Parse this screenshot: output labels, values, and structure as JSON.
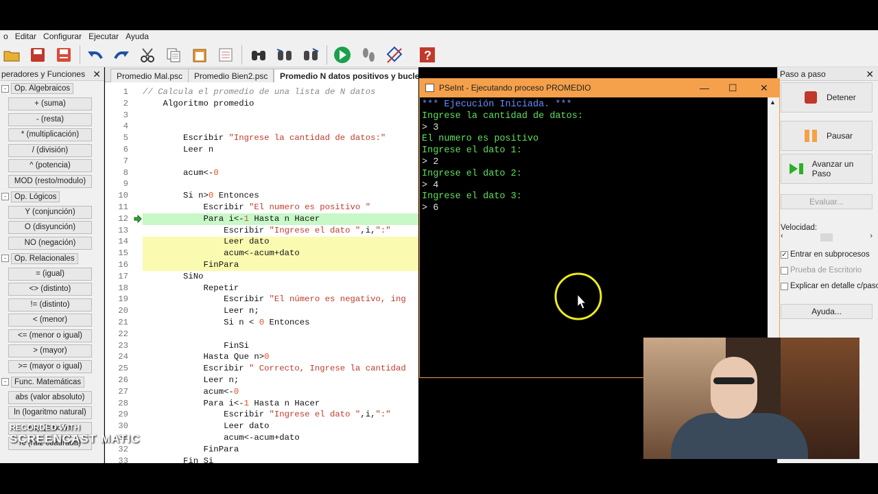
{
  "menu": [
    "o",
    "Editar",
    "Configurar",
    "Ejecutar",
    "Ayuda"
  ],
  "left_panel": {
    "title": "perador es y Funciones",
    "title_text": "peradores y Funciones",
    "items": [
      {
        "kind": "cat",
        "label": "Op. Algebraicos",
        "box": "-"
      },
      {
        "kind": "op",
        "label": "+ (suma)"
      },
      {
        "kind": "op",
        "label": "- (resta)"
      },
      {
        "kind": "op",
        "label": "* (multiplicación)"
      },
      {
        "kind": "op",
        "label": "/ (división)"
      },
      {
        "kind": "op",
        "label": "^ (potencia)"
      },
      {
        "kind": "op",
        "label": "MOD (resto/modulo)"
      },
      {
        "kind": "cat",
        "label": "Op. Lógicos",
        "box": "-"
      },
      {
        "kind": "op",
        "label": "Y (conjunción)"
      },
      {
        "kind": "op",
        "label": "O (disyunción)"
      },
      {
        "kind": "op",
        "label": "NO (negación)"
      },
      {
        "kind": "cat",
        "label": "Op. Relacionales",
        "box": "-"
      },
      {
        "kind": "op",
        "label": "= (igual)"
      },
      {
        "kind": "op",
        "label": "<> (distinto)"
      },
      {
        "kind": "op",
        "label": "!= (distinto)"
      },
      {
        "kind": "op",
        "label": "< (menor)"
      },
      {
        "kind": "op",
        "label": "<= (menor o igual)"
      },
      {
        "kind": "op",
        "label": "> (mayor)"
      },
      {
        "kind": "op",
        "label": ">= (mayor o igual)"
      },
      {
        "kind": "cat",
        "label": "Func. Matemáticas",
        "box": "-"
      },
      {
        "kind": "op",
        "label": "abs (valor absoluto)"
      },
      {
        "kind": "op",
        "label": "ln (logaritmo natural)"
      },
      {
        "kind": "op",
        "label": "exp (función exponencial)"
      },
      {
        "kind": "op",
        "label": "rc (raiz cuadrada)"
      }
    ]
  },
  "tabs": [
    "Promedio Mal.psc",
    "Promedio Bien2.psc",
    "Promedio N datos positivos y bucle.psc"
  ],
  "code_lines": [
    {
      "n": "1",
      "t": "// Calcula el promedio de una lista de N datos",
      "style": "cmt"
    },
    {
      "n": "2",
      "t": "    Algoritmo promedio",
      "style": "kw"
    },
    {
      "n": "3",
      "t": "",
      "style": "kw"
    },
    {
      "n": "4",
      "t": "",
      "style": "kw"
    },
    {
      "n": "5",
      "t": "        Escribir \"Ingrese la cantidad de datos:\"",
      "style": "mix"
    },
    {
      "n": "6",
      "t": "        Leer n",
      "style": "kw"
    },
    {
      "n": "7",
      "t": "",
      "style": "kw"
    },
    {
      "n": "8",
      "t": "        acum<-0",
      "style": "kw"
    },
    {
      "n": "9",
      "t": "",
      "style": "kw"
    },
    {
      "n": "10",
      "t": "        Si n>0 Entonces",
      "style": "kw"
    },
    {
      "n": "11",
      "t": "            Escribir \"El numero es positivo \"",
      "style": "mix"
    },
    {
      "n": "12",
      "t": "            Para i<-1 Hasta n Hacer",
      "style": "kw"
    },
    {
      "n": "13",
      "t": "                Escribir \"Ingrese el dato \",i,\":\"",
      "style": "mix"
    },
    {
      "n": "14",
      "t": "                Leer dato",
      "style": "kw"
    },
    {
      "n": "15",
      "t": "                acum<-acum+dato",
      "style": "kw"
    },
    {
      "n": "16",
      "t": "            FinPara",
      "style": "kw"
    },
    {
      "n": "17",
      "t": "        SiNo",
      "style": "kw"
    },
    {
      "n": "18",
      "t": "            Repetir",
      "style": "kw"
    },
    {
      "n": "19",
      "t": "                Escribir \"El número es negativo, ing",
      "style": "mix"
    },
    {
      "n": "20",
      "t": "                Leer n;",
      "style": "kw"
    },
    {
      "n": "21",
      "t": "                Si n < 0 Entonces",
      "style": "kw"
    },
    {
      "n": "22",
      "t": "",
      "style": "kw"
    },
    {
      "n": "23",
      "t": "                FinSi",
      "style": "kw"
    },
    {
      "n": "24",
      "t": "            Hasta Que n>0",
      "style": "kw"
    },
    {
      "n": "25",
      "t": "            Escribir \" Correcto, Ingrese la cantidad",
      "style": "mix"
    },
    {
      "n": "26",
      "t": "            Leer n;",
      "style": "kw"
    },
    {
      "n": "27",
      "t": "            acum<-0",
      "style": "kw"
    },
    {
      "n": "28",
      "t": "            Para i<-1 Hasta n Hacer",
      "style": "kw"
    },
    {
      "n": "29",
      "t": "                Escribir \"Ingrese el dato \",i,\":\"",
      "style": "mix"
    },
    {
      "n": "30",
      "t": "                Leer dato",
      "style": "kw"
    },
    {
      "n": "31",
      "t": "                acum<-acum+dato",
      "style": "kw"
    },
    {
      "n": "32",
      "t": "            FinPara",
      "style": "kw"
    },
    {
      "n": "33",
      "t": "        Fin Si",
      "style": "kw"
    }
  ],
  "right_panel": {
    "title": "Paso a paso",
    "detener": "Detener",
    "pausar": "Pausar",
    "avanzar": "Avanzar un Paso",
    "evaluar": "Evaluar...",
    "velocidad": "Velocidad:",
    "entrar": "Entrar en subprocesos",
    "prueba": "Prueba de Escritorio",
    "explicar": "Explicar en detalle c/paso",
    "ayuda": "Ayuda..."
  },
  "console": {
    "title": "PSeInt - Ejecutando proceso PROMEDIO",
    "lines": [
      {
        "t": "*** Ejecución Iniciada. ***",
        "c": "blue"
      },
      {
        "t": "Ingrese la cantidad de datos:",
        "c": "green"
      },
      {
        "t": "> 3",
        "c": "in"
      },
      {
        "t": "El numero es positivo",
        "c": "green"
      },
      {
        "t": "Ingrese el dato 1:",
        "c": "green"
      },
      {
        "t": "> 2",
        "c": "in"
      },
      {
        "t": "Ingrese el dato 2:",
        "c": "green"
      },
      {
        "t": "> 4",
        "c": "in"
      },
      {
        "t": "Ingrese el dato 3:",
        "c": "green"
      },
      {
        "t": "> 6",
        "c": "in"
      }
    ]
  },
  "watermark": {
    "top": "RECORDED WITH",
    "bottom": "SCREENCAST MATIC"
  },
  "colors": {
    "console_border": "#f5a04a",
    "console_text": "#5ee05e",
    "highlight_current": "#c8f7c8",
    "highlight_block": "#fafab0"
  }
}
